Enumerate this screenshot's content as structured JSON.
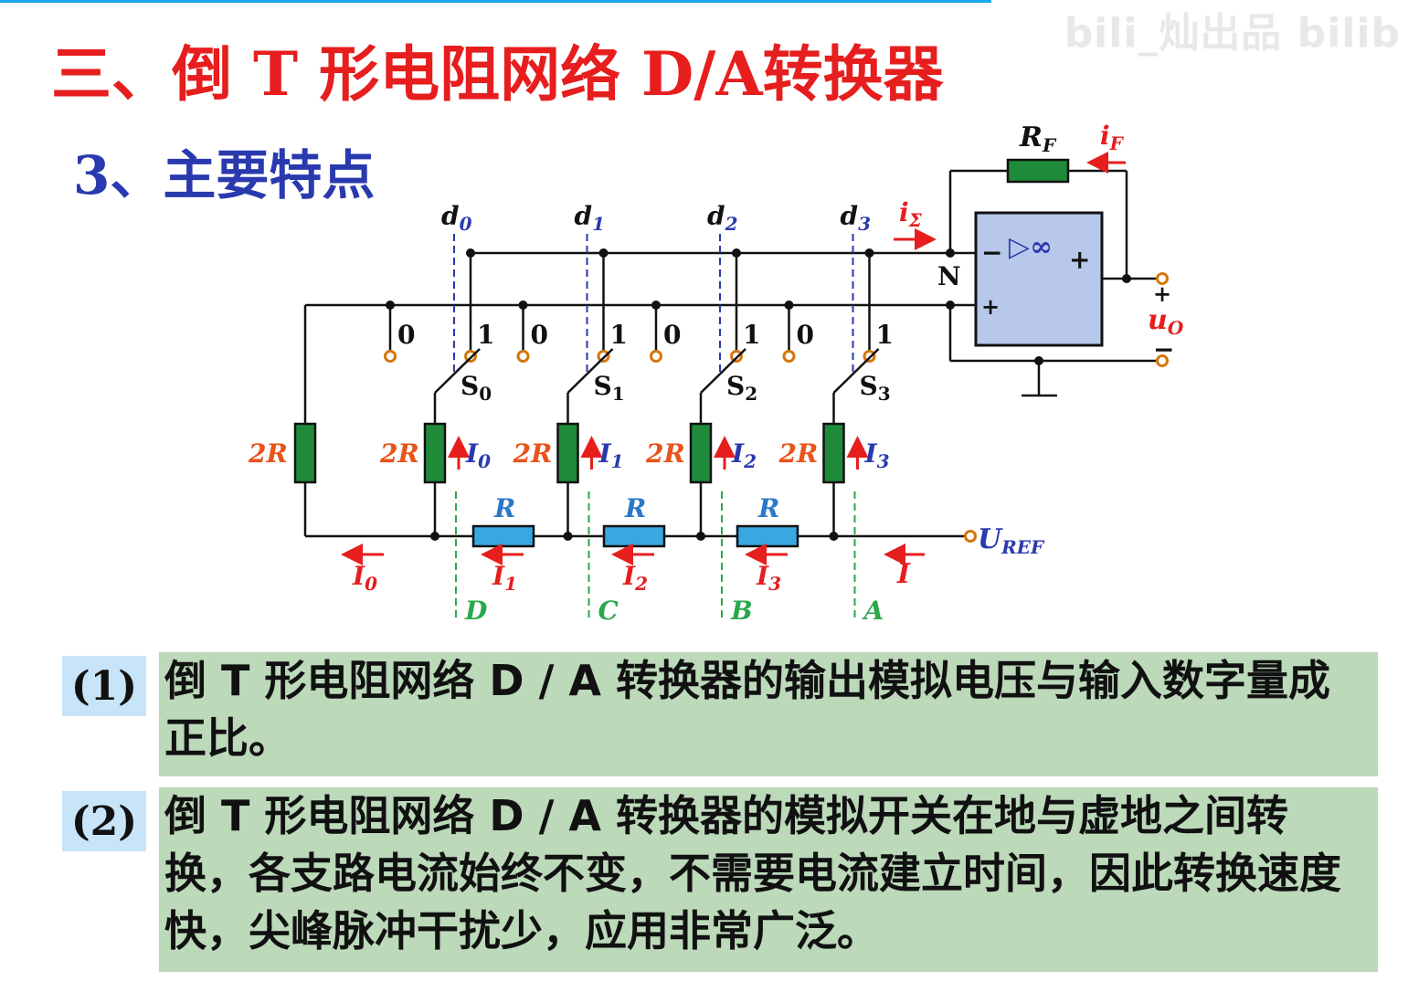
{
  "header": {
    "watermark": "bili_灿出品 bilib",
    "title": "三、倒 T 形电阻网络 D/A转换器",
    "subtitle": "3、主要特点"
  },
  "diagram": {
    "feedback_resistor": "R",
    "feedback_resistor_sub": "F",
    "feedback_current": "i",
    "feedback_current_sub": "F",
    "sum_current": "i",
    "sum_current_sub": "Σ",
    "node_n": "N",
    "opamp_symbol": "▷∞",
    "opamp_minus": "−",
    "opamp_plus": "+",
    "out_plus": "+",
    "out_minus": "−",
    "out_label": "u",
    "out_label_sub": "O",
    "ref_label": "U",
    "ref_label_sub": "REF",
    "total_current": "I",
    "resistor_2r": "2R",
    "resistor_r": "R",
    "switch_pos_0": "0",
    "switch_pos_1": "1",
    "data_bits": [
      {
        "d": "d",
        "sub": "0",
        "switch": "S",
        "switch_sub": "0",
        "branch": "I",
        "branch_sub": "0",
        "node": "D"
      },
      {
        "d": "d",
        "sub": "1",
        "switch": "S",
        "switch_sub": "1",
        "branch": "I",
        "branch_sub": "1",
        "node": "C"
      },
      {
        "d": "d",
        "sub": "2",
        "switch": "S",
        "switch_sub": "2",
        "branch": "I",
        "branch_sub": "2",
        "node": "B"
      },
      {
        "d": "d",
        "sub": "3",
        "switch": "S",
        "switch_sub": "3",
        "branch": "I",
        "branch_sub": "3",
        "node": "A"
      }
    ],
    "bottom_currents": [
      {
        "label": "I",
        "sub": "0"
      },
      {
        "label": "I",
        "sub": "1"
      },
      {
        "label": "I",
        "sub": "2"
      },
      {
        "label": "I",
        "sub": "3"
      }
    ]
  },
  "features": [
    {
      "tag": "(1)",
      "text": "倒 T 形电阻网络 D / A 转换器的输出模拟电压与输入数字量成正比。"
    },
    {
      "tag": "(2)",
      "text": "倒 T 形电阻网络 D / A 转换器的模拟开关在地与虚地之间转换，各支路电流始终不变，不需要电流建立时间，因此转换速度快，尖峰脉冲干扰少，应用非常广泛。"
    }
  ],
  "colors": {
    "title": "#e61e1e",
    "subtitle": "#2a3aae",
    "resistor_2r": "#1e8a3a",
    "resistor_r": "#38a8e0",
    "current_arrow": "#e61e1e",
    "opamp_fill": "#b7c8ea",
    "tag_bg": "#c8e4f8",
    "box_bg": "#bcd9ba"
  }
}
